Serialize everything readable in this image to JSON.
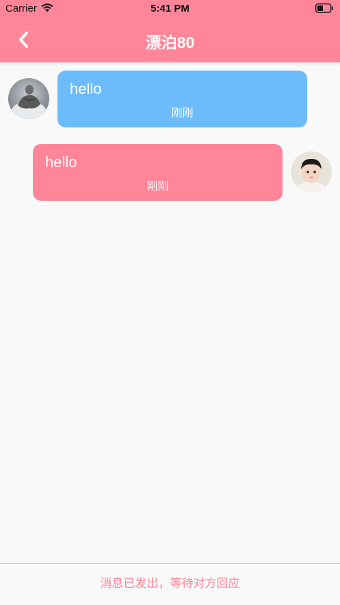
{
  "status_bar": {
    "carrier": "Carrier",
    "time": "5:41 PM",
    "wifi_icon": "wifi-icon",
    "battery_icon": "battery-icon"
  },
  "header": {
    "title": "漂泊80",
    "back_icon": "chevron-left-icon",
    "color": "#ff8599"
  },
  "messages": [
    {
      "side": "left",
      "text": "hello",
      "time": "刚刚",
      "bubble_color": "#6cbcfb",
      "avatar": "avatar-man"
    },
    {
      "side": "right",
      "text": "hello",
      "time": "刚刚",
      "bubble_color": "#ff8599",
      "avatar": "avatar-child"
    }
  ],
  "footer": {
    "status_text": "消息已发出，等待对方回应"
  }
}
